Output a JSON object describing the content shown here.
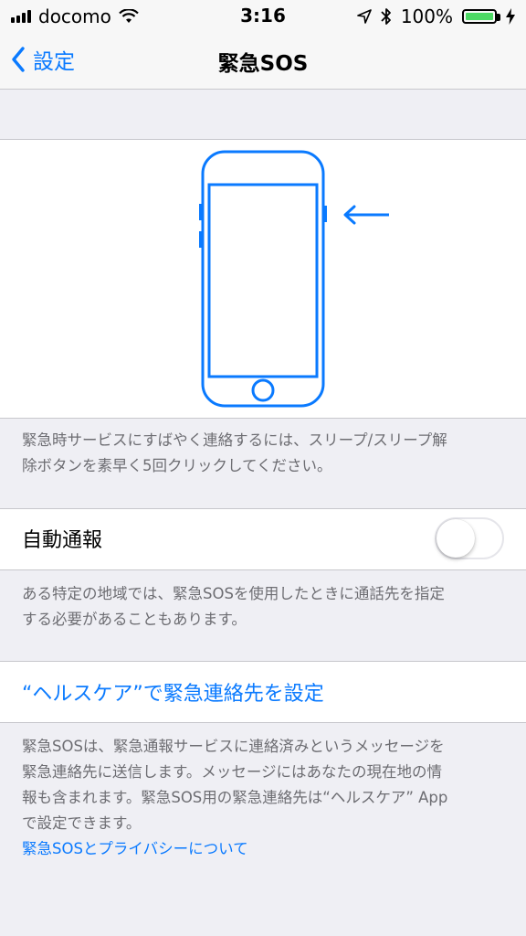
{
  "status_bar": {
    "carrier": "docomo",
    "time": "3:16",
    "battery": "100%"
  },
  "nav": {
    "back_label": "設定",
    "title": "緊急SOS"
  },
  "illustration": {
    "description_line1": "緊急時サービスにすばやく連絡するには、スリープ/スリープ解",
    "description_line2": "除ボタンを素早く5回クリックしてください。"
  },
  "auto_call": {
    "label": "自動通報",
    "enabled": false,
    "footer_line1": "ある特定の地域では、緊急SOSを使用したときに通話先を指定",
    "footer_line2": "する必要があることもあります。"
  },
  "emergency_contacts": {
    "label": "“ヘルスケア”で緊急連絡先を設定",
    "footer_line1": "緊急SOSは、緊急通報サービスに連絡済みというメッセージを",
    "footer_line2": "緊急連絡先に送信します。メッセージにはあなたの現在地の情",
    "footer_line3": "報も含まれます。緊急SOS用の緊急連絡先は“ヘルスケア” App",
    "footer_line4": "で設定できます。",
    "privacy_link": "緊急SOSとプライバシーについて"
  },
  "colors": {
    "accent": "#0a7aff",
    "background": "#efeff4",
    "battery": "#4cd964"
  }
}
